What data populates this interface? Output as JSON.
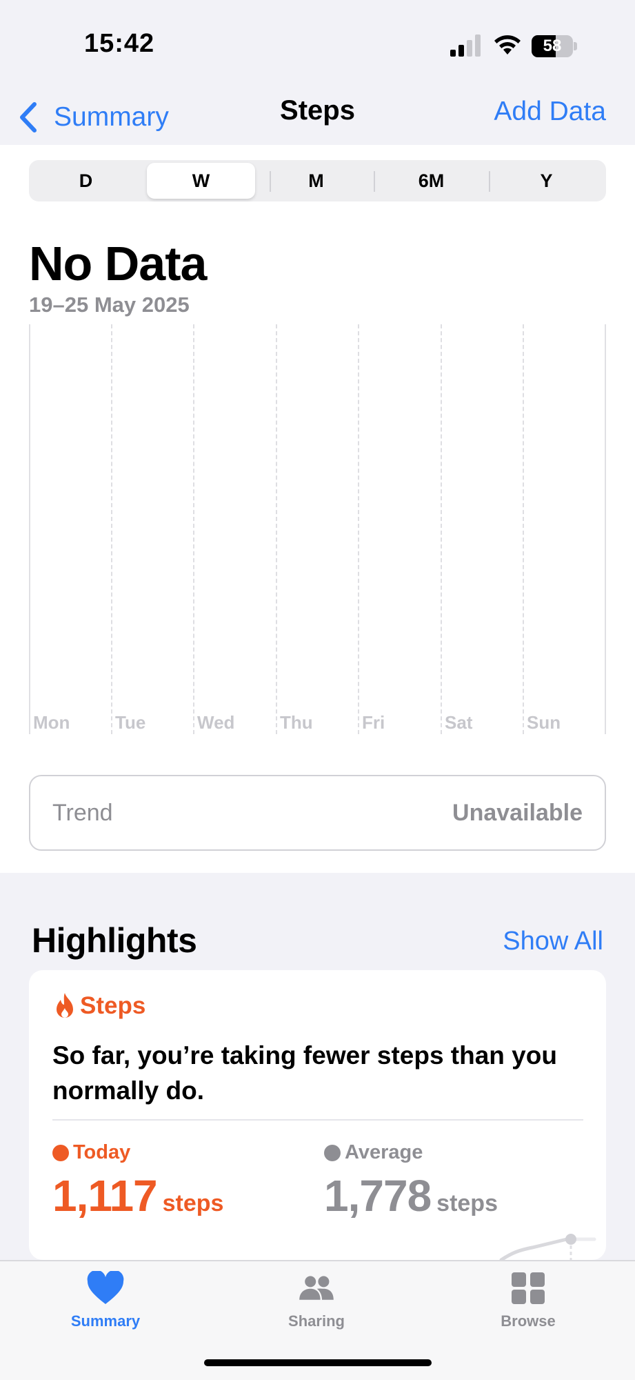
{
  "status_bar": {
    "time": "15:42",
    "battery": "58",
    "battery_level": 0.58,
    "icons": [
      "signal-icon",
      "wifi-icon",
      "battery-icon"
    ]
  },
  "nav": {
    "back_label": "Summary",
    "title": "Steps",
    "add_data_label": "Add Data"
  },
  "range_tabs": {
    "items": [
      "D",
      "W",
      "M",
      "6M",
      "Y"
    ],
    "selected": "W"
  },
  "summary": {
    "headline": "No Data",
    "date_range": "19–25 May 2025"
  },
  "chart": {
    "days": [
      "Mon",
      "Tue",
      "Wed",
      "Thu",
      "Fri",
      "Sat",
      "Sun"
    ]
  },
  "trend": {
    "label": "Trend",
    "value": "Unavailable"
  },
  "highlights": {
    "title": "Highlights",
    "show_all_label": "Show All",
    "card": {
      "category": "Steps",
      "text": "So far, you’re taking fewer steps than you normally do.",
      "today": {
        "label": "Today",
        "value": "1,117",
        "unit": "steps"
      },
      "average": {
        "label": "Average",
        "value": "1,778",
        "unit": "steps"
      }
    }
  },
  "tab_bar": {
    "items": [
      {
        "label": "Summary",
        "icon": "heart-icon"
      },
      {
        "label": "Sharing",
        "icon": "people-icon"
      },
      {
        "label": "Browse",
        "icon": "grid-icon"
      }
    ],
    "selected": "Summary"
  },
  "colors": {
    "accent": "#2f7df6",
    "highlight": "#ee5a24",
    "secondary": "#8e8e93",
    "background": "#f2f2f7"
  }
}
